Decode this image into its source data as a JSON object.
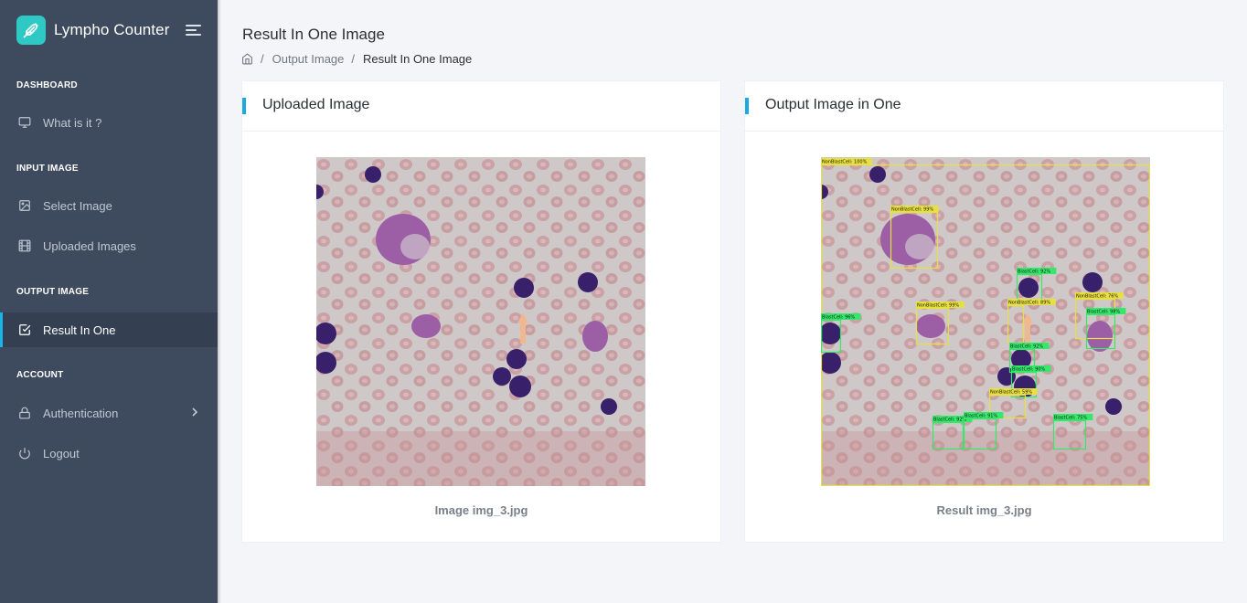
{
  "app": {
    "name": "Lympho Counter"
  },
  "sidebar": {
    "sections": [
      {
        "title": "DASHBOARD",
        "items": [
          {
            "label": "What is it ?",
            "icon": "monitor-icon"
          }
        ]
      },
      {
        "title": "INPUT IMAGE",
        "items": [
          {
            "label": "Select Image",
            "icon": "image-icon"
          },
          {
            "label": "Uploaded Images",
            "icon": "film-icon"
          }
        ]
      },
      {
        "title": "OUTPUT IMAGE",
        "items": [
          {
            "label": "Result In One",
            "icon": "check-square-icon",
            "active": true
          }
        ]
      },
      {
        "title": "ACCOUNT",
        "items": [
          {
            "label": "Authentication",
            "icon": "lock-icon",
            "has_submenu": true
          },
          {
            "label": "Logout",
            "icon": "power-icon"
          }
        ]
      }
    ]
  },
  "page": {
    "title": "Result In One Image",
    "breadcrumb": {
      "home_icon": "home-icon",
      "separator": "/",
      "link": "Output Image",
      "current": "Result In One Image"
    }
  },
  "cards": {
    "uploaded": {
      "title": "Uploaded Image",
      "caption": "Image img_3.jpg"
    },
    "output": {
      "title": "Output Image in One",
      "caption": "Result img_3.jpg",
      "detections": [
        {
          "label": "NonBlastCell: 100%",
          "color": "#e8e040"
        },
        {
          "label": "NonBlastCell: 99%",
          "color": "#e8e040"
        },
        {
          "label": "BlastCell: 92%",
          "color": "#34e86a"
        },
        {
          "label": "NonBlastCell: 99%",
          "color": "#e8e040"
        },
        {
          "label": "NonBlastCell: 89%",
          "color": "#e8e040"
        },
        {
          "label": "NonBlastCell: 76%",
          "color": "#e8e040"
        },
        {
          "label": "BlastCell: 98%",
          "color": "#34e86a"
        },
        {
          "label": "BlastCell: 96%",
          "color": "#34e86a"
        },
        {
          "label": "BlastCell: 92%",
          "color": "#34e86a"
        },
        {
          "label": "BlastCell: 90%",
          "color": "#34e86a"
        },
        {
          "label": "NonBlastCell: 59%",
          "color": "#e8e040"
        },
        {
          "label": "BlastCell: 92%",
          "color": "#34e86a"
        },
        {
          "label": "BlastCell: 91%",
          "color": "#34e86a"
        },
        {
          "label": "BlastCell: 75%",
          "color": "#34e86a"
        }
      ]
    }
  },
  "colors": {
    "sidebar_bg": "#3e4b5e",
    "accent": "#1aa9e0",
    "brand": "#2ec9c5",
    "blast_box": "#34e86a",
    "nonblast_box": "#e8e040"
  }
}
